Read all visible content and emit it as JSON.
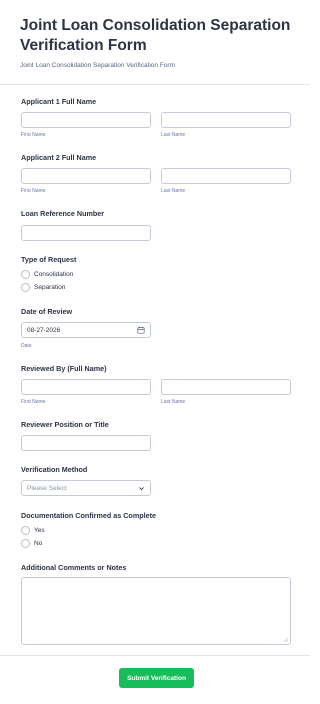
{
  "form": {
    "title": "Joint Loan Consolidation Separation Verification Form",
    "subtitle": "Joint Loan Consolidation Separation Verification Form"
  },
  "applicant1": {
    "label": "Applicant 1 Full Name",
    "first_sub": "First Name",
    "last_sub": "Last Name"
  },
  "applicant2": {
    "label": "Applicant 2 Full Name",
    "first_sub": "First Name",
    "last_sub": "Last Name"
  },
  "loan_ref": {
    "label": "Loan Reference Number"
  },
  "request_type": {
    "label": "Type of Request",
    "options": [
      "Consolidation",
      "Separation"
    ]
  },
  "review_date": {
    "label": "Date of Review",
    "value": "08-27-2026",
    "sub": "Date",
    "icon": "calendar-icon"
  },
  "reviewed_by": {
    "label": "Reviewed By (Full Name)",
    "first_sub": "First Name",
    "last_sub": "Last Name"
  },
  "reviewer_position": {
    "label": "Reviewer Position or Title"
  },
  "verification_method": {
    "label": "Verification Method",
    "placeholder": "Please Select",
    "icon": "chevron-down-icon"
  },
  "docs_confirmed": {
    "label": "Documentation Confirmed as Complete",
    "options": [
      "Yes",
      "No"
    ]
  },
  "comments": {
    "label": "Additional Comments or Notes"
  },
  "submit": {
    "label": "Submit Verification",
    "color": "#18bd5b"
  }
}
